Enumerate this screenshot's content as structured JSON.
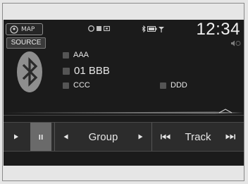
{
  "status_bar": {
    "map_label": "MAP",
    "time": "12:34"
  },
  "source": {
    "label": "SOURCE"
  },
  "now_playing": {
    "artist": "AAA",
    "title": "01 BBB",
    "album": "CCC",
    "genre": "DDD"
  },
  "controls": {
    "group_label": "Group",
    "track_label": "Track"
  },
  "colors": {
    "screen_bg": "#1b1b1b",
    "control_bar_bg": "#2c2c2c",
    "pause_active_bg": "#6a6a6a",
    "text": "#e8e8e8"
  },
  "icons": {
    "map": "map-pin-icon",
    "bluetooth": "bluetooth-icon",
    "play": "play-icon",
    "pause": "pause-icon",
    "prev_group": "triangle-left-icon",
    "next_group": "triangle-right-icon",
    "prev_track": "skip-back-icon",
    "next_track": "skip-forward-icon"
  }
}
